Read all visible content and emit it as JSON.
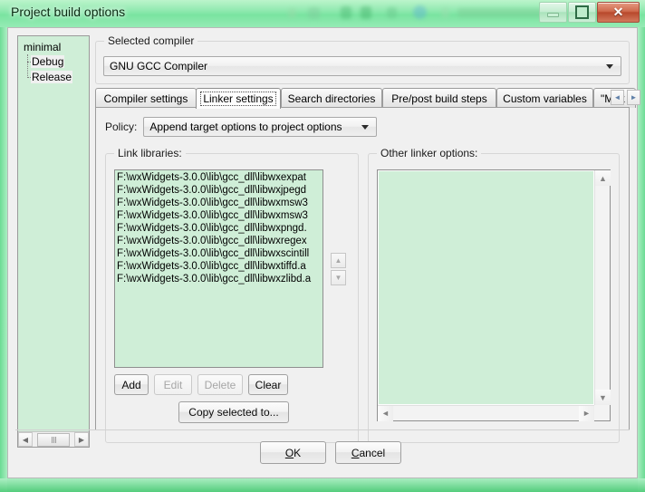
{
  "window": {
    "title": "Project build options",
    "buttons": {
      "minimize": "Minimize",
      "restore": "Restore",
      "close": "✕",
      "close_name": "Close"
    }
  },
  "tree": {
    "root": "minimal",
    "children": [
      "Debug",
      "Release"
    ]
  },
  "compiler_group": {
    "title": "Selected compiler",
    "selected": "GNU GCC Compiler"
  },
  "tabs": [
    {
      "label": "Compiler settings",
      "active": false
    },
    {
      "label": "Linker settings",
      "active": true
    },
    {
      "label": "Search directories",
      "active": false
    },
    {
      "label": "Pre/post build steps",
      "active": false
    },
    {
      "label": "Custom variables",
      "active": false
    },
    {
      "label": "\"Mak",
      "active": false
    }
  ],
  "tab_nav": {
    "prev": "◄",
    "next": "►"
  },
  "policy": {
    "label": "Policy:",
    "value": "Append target options to project options"
  },
  "link_libraries": {
    "group_title": "Link libraries:",
    "items": [
      "F:\\wxWidgets-3.0.0\\lib\\gcc_dll\\libwxexpat",
      "F:\\wxWidgets-3.0.0\\lib\\gcc_dll\\libwxjpegd",
      "F:\\wxWidgets-3.0.0\\lib\\gcc_dll\\libwxmsw3",
      "F:\\wxWidgets-3.0.0\\lib\\gcc_dll\\libwxmsw3",
      "F:\\wxWidgets-3.0.0\\lib\\gcc_dll\\libwxpngd.",
      "F:\\wxWidgets-3.0.0\\lib\\gcc_dll\\libwxregex",
      "F:\\wxWidgets-3.0.0\\lib\\gcc_dll\\libwxscintill",
      "F:\\wxWidgets-3.0.0\\lib\\gcc_dll\\libwxtiffd.a",
      "F:\\wxWidgets-3.0.0\\lib\\gcc_dll\\libwxzlibd.a"
    ],
    "reorder": {
      "up": "▲",
      "down": "▼"
    },
    "buttons": [
      {
        "label": "Add",
        "enabled": true
      },
      {
        "label": "Edit",
        "enabled": false
      },
      {
        "label": "Delete",
        "enabled": false
      },
      {
        "label": "Clear",
        "enabled": true
      }
    ],
    "copy_button": "Copy selected to..."
  },
  "other_linker_options": {
    "group_title": "Other linker options:",
    "value": "",
    "scroll": {
      "up": "▲",
      "down": "▼",
      "left": "◄",
      "right": "►"
    }
  },
  "dialog_buttons": {
    "ok": {
      "pre": "",
      "mnemonic": "O",
      "post": "K"
    },
    "cancel": {
      "pre": "",
      "mnemonic": "C",
      "post": "ancel"
    }
  },
  "colors": {
    "glass_green": "#5fd484",
    "field_green": "#cfeed7",
    "dialog_face": "#f0f0f0",
    "close_red": "#c0522f"
  }
}
